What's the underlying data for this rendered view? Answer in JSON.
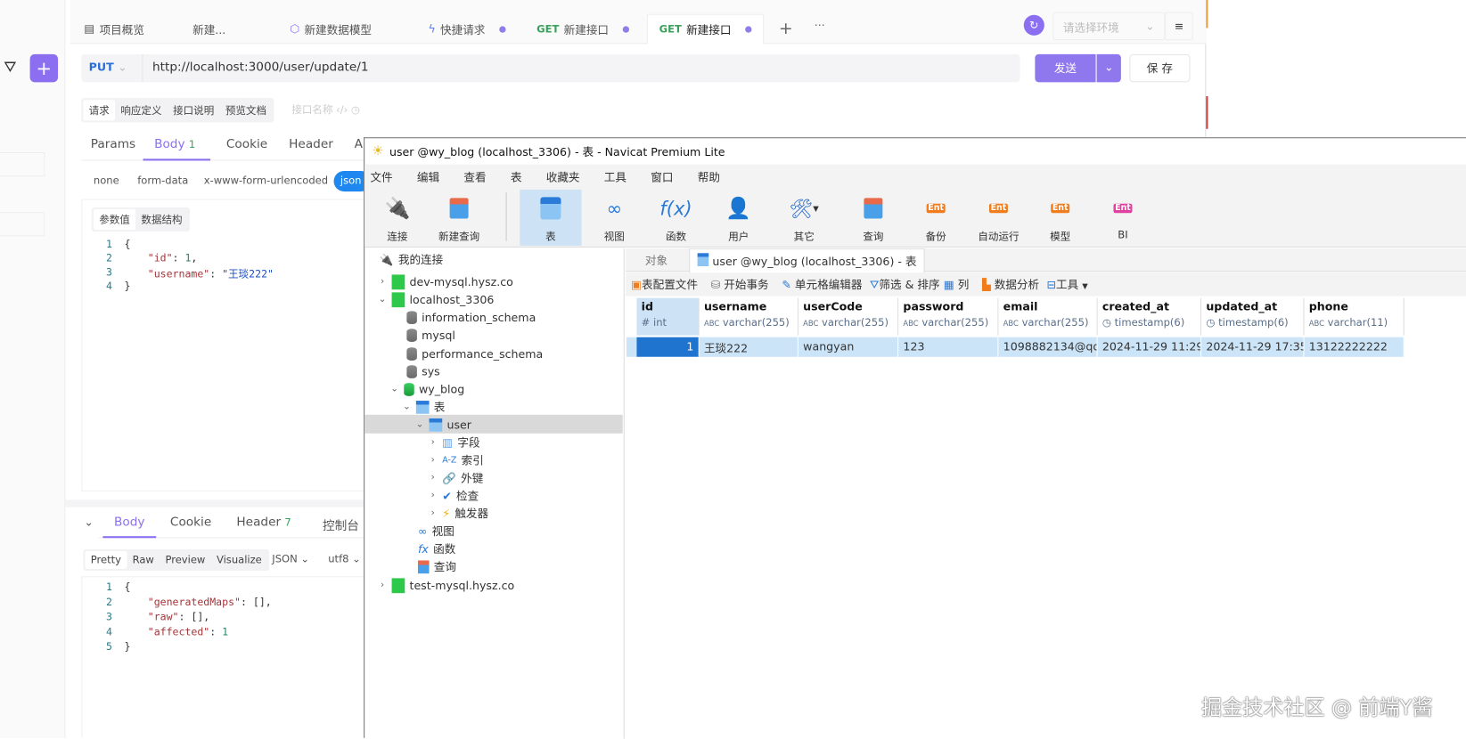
{
  "apifox": {
    "tabs": [
      {
        "label": "项目概览",
        "icon": "layout-icon"
      },
      {
        "label": "新建..."
      },
      {
        "label": "新建数据模型",
        "icon": "model-icon"
      },
      {
        "label": "快捷请求",
        "icon": "lightning-icon"
      },
      {
        "method": "GET",
        "label": "新建接口"
      },
      {
        "method": "GET",
        "label": "新建接口",
        "active": true
      }
    ],
    "env_placeholder": "请选择环境",
    "method": "PUT",
    "url": "http://localhost:3000/user/update/1",
    "send": "发送",
    "save": "保 存",
    "doc_tabs": [
      "请求",
      "响应定义",
      "接口说明",
      "预览文档"
    ],
    "name_placeholder": "接口名称",
    "req_tabs": [
      {
        "label": "Params"
      },
      {
        "label": "Body",
        "count": "1",
        "active": true
      },
      {
        "label": "Cookie"
      },
      {
        "label": "Header"
      },
      {
        "label": "A"
      }
    ],
    "body_types": [
      "none",
      "form-data",
      "x-www-form-urlencoded",
      "json"
    ],
    "param_tabs": [
      "参数值",
      "数据结构"
    ],
    "request_body": {
      "lines": [
        "1",
        "2",
        "3",
        "4"
      ],
      "id_key": "\"id\"",
      "id_val": "1",
      "name_key": "\"username\"",
      "name_val": "\"王琰222\""
    },
    "resp_tabs": [
      {
        "label": "Body",
        "active": true
      },
      {
        "label": "Cookie"
      },
      {
        "label": "Header",
        "count": "7"
      },
      {
        "label": "控制台"
      }
    ],
    "resp_views": [
      "Pretty",
      "Raw",
      "Preview",
      "Visualize"
    ],
    "resp_format": "JSON",
    "resp_encoding": "utf8",
    "response_body": {
      "lines": [
        "1",
        "2",
        "3",
        "4",
        "5"
      ],
      "k1": "\"generatedMaps\"",
      "v1": "[],",
      "k2": "\"raw\"",
      "v2": "[],",
      "k3": "\"affected\"",
      "v3": "1"
    },
    "accent": "#8b6ff0"
  },
  "navicat": {
    "title": "user @wy_blog (localhost_3306) - 表 - Navicat Premium Lite",
    "menu": [
      "文件",
      "编辑",
      "查看",
      "表",
      "收藏夹",
      "工具",
      "窗口",
      "帮助"
    ],
    "toolbar": [
      "连接",
      "新建查询",
      "表",
      "视图",
      "函数",
      "用户",
      "其它",
      "查询",
      "备份",
      "自动运行",
      "模型",
      "BI"
    ],
    "tree": {
      "root": "我的连接",
      "conn1": "dev-mysql.hysz.co",
      "conn2": "localhost_3306",
      "dbs": [
        "information_schema",
        "mysql",
        "performance_schema",
        "sys"
      ],
      "db": "wy_blog",
      "tables": "表",
      "table": "user",
      "children": [
        "字段",
        "索引",
        "外键",
        "检查",
        "触发器"
      ],
      "others": [
        "视图",
        "函数",
        "查询"
      ],
      "conn3": "test-mysql.hysz.co"
    },
    "tabs": {
      "objects": "对象",
      "current": "user @wy_blog (localhost_3306) - 表"
    },
    "subtoolbar": [
      "表配置文件",
      "开始事务",
      "单元格编辑器",
      "筛选 & 排序",
      "列",
      "数据分析",
      "工具"
    ],
    "columns": [
      {
        "name": "id",
        "type": "int",
        "icon": "hash-icon"
      },
      {
        "name": "username",
        "type": "varchar(255)",
        "icon": "abc-icon"
      },
      {
        "name": "userCode",
        "type": "varchar(255)",
        "icon": "abc-icon"
      },
      {
        "name": "password",
        "type": "varchar(255)",
        "icon": "abc-icon"
      },
      {
        "name": "email",
        "type": "varchar(255)",
        "icon": "abc-icon"
      },
      {
        "name": "created_at",
        "type": "timestamp(6)",
        "icon": "clock-icon"
      },
      {
        "name": "updated_at",
        "type": "timestamp(6)",
        "icon": "clock-icon"
      },
      {
        "name": "phone",
        "type": "varchar(11)",
        "icon": "abc-icon"
      }
    ],
    "rows": [
      [
        "1",
        "王琰222",
        "wangyan",
        "123",
        "1098882134@qq.",
        "2024-11-29 11:29:",
        "2024-11-29 17:35:",
        "13122222222"
      ]
    ]
  },
  "watermark": "掘金技术社区 @ 前端Y酱"
}
